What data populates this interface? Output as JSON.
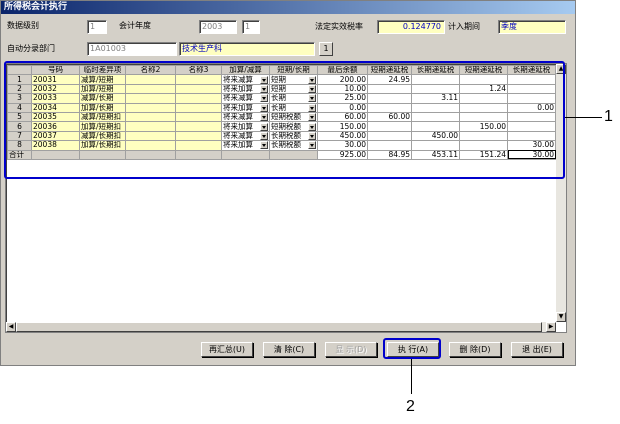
{
  "window": {
    "title": "所得税会计执行"
  },
  "form": {
    "data_level_label": "数据级别",
    "data_level_value": "1",
    "fiscal_year_label": "会计年度",
    "fiscal_year_value": "2003",
    "period_value": "1",
    "statutory_rate_label": "法定实效税率",
    "statutory_rate_value": "0.124770",
    "include_period_label": "计入期间",
    "include_period_value": "季度",
    "auto_dept_label": "自动分录部门",
    "dept_code_value": "1A01003",
    "dept_name_value": "技术生产科",
    "dept_browse_label": "1"
  },
  "grid": {
    "columns": [
      "号码",
      "临时差异项",
      "名称2",
      "名称3",
      "加算/减算",
      "短期/长期",
      "最后余额",
      "短期递延税",
      "长期递延税",
      "短期递延税",
      "长期递延税"
    ],
    "rows": [
      {
        "num": "1",
        "code": "20031",
        "item": "减算/短期",
        "n2": "",
        "n3": "",
        "addsub": "将来减算",
        "term": "短期",
        "balance": "200.00",
        "st1": "24.95",
        "lt1": "",
        "st2": "",
        "lt2": ""
      },
      {
        "num": "2",
        "code": "20032",
        "item": "加算/短期",
        "n2": "",
        "n3": "",
        "addsub": "将来加算",
        "term": "短期",
        "balance": "10.00",
        "st1": "",
        "lt1": "",
        "st2": "1.24",
        "lt2": ""
      },
      {
        "num": "3",
        "code": "20033",
        "item": "减算/长期",
        "n2": "",
        "n3": "",
        "addsub": "将来减算",
        "term": "长期",
        "balance": "25.00",
        "st1": "",
        "lt1": "3.11",
        "st2": "",
        "lt2": ""
      },
      {
        "num": "4",
        "code": "20034",
        "item": "加算/长期",
        "n2": "",
        "n3": "",
        "addsub": "将来加算",
        "term": "长期",
        "balance": "0.00",
        "st1": "",
        "lt1": "",
        "st2": "",
        "lt2": "0.00"
      },
      {
        "num": "5",
        "code": "20035",
        "item": "减算/短期扣",
        "n2": "",
        "n3": "",
        "addsub": "将来减算",
        "term": "短期税额",
        "balance": "60.00",
        "st1": "60.00",
        "lt1": "",
        "st2": "",
        "lt2": ""
      },
      {
        "num": "6",
        "code": "20036",
        "item": "加算/短期扣",
        "n2": "",
        "n3": "",
        "addsub": "将来加算",
        "term": "短期税额",
        "balance": "150.00",
        "st1": "",
        "lt1": "",
        "st2": "150.00",
        "lt2": ""
      },
      {
        "num": "7",
        "code": "20037",
        "item": "减算/长期扣",
        "n2": "",
        "n3": "",
        "addsub": "将来减算",
        "term": "长期税额",
        "balance": "450.00",
        "st1": "",
        "lt1": "450.00",
        "st2": "",
        "lt2": ""
      },
      {
        "num": "8",
        "code": "20038",
        "item": "加算/长期扣",
        "n2": "",
        "n3": "",
        "addsub": "将来加算",
        "term": "长期税额",
        "balance": "30.00",
        "st1": "",
        "lt1": "",
        "st2": "",
        "lt2": "30.00"
      }
    ],
    "total": {
      "label": "合计",
      "balance": "925.00",
      "st1": "84.95",
      "lt1": "453.11",
      "st2": "151.24",
      "lt2": "30.00"
    }
  },
  "buttons": {
    "resum": "再汇总(U)",
    "clear": "清  除(C)",
    "display": "显  示(D)",
    "execute": "执  行(A)",
    "delete": "删  除(D)",
    "exit": "退  出(E)"
  },
  "callouts": {
    "one": "1",
    "two": "2"
  },
  "colors": {
    "titlebar": "#0a246a",
    "input_yellow": "#ffffc0",
    "highlight": "#0000cc",
    "window": "#d4d0c8"
  }
}
